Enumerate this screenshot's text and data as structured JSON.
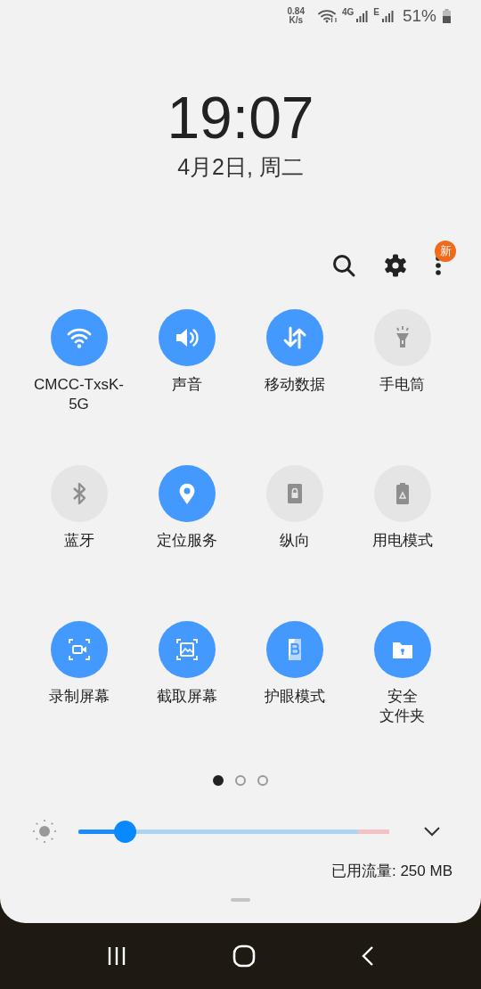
{
  "status_bar": {
    "speed_value": "0.84",
    "speed_unit": "K/s",
    "network_1": "4G",
    "network_2": "E",
    "battery": "51%"
  },
  "clock": {
    "time": "19:07",
    "date": "4月2日, 周二"
  },
  "toolbar": {
    "badge": "新"
  },
  "tiles": [
    {
      "label": [
        "CMCC-TxsK-5G"
      ],
      "on": true
    },
    {
      "label": [
        "声音"
      ],
      "on": true
    },
    {
      "label": [
        "移动数据"
      ],
      "on": true
    },
    {
      "label": [
        "手电筒"
      ],
      "on": false
    },
    {
      "label": [
        "蓝牙"
      ],
      "on": false
    },
    {
      "label": [
        "定位服务"
      ],
      "on": true
    },
    {
      "label": [
        "纵向"
      ],
      "on": false
    },
    {
      "label": [
        "用电模式"
      ],
      "on": false
    },
    {
      "label": [
        "录制屏幕"
      ],
      "on": true
    },
    {
      "label": [
        "截取屏幕"
      ],
      "on": true
    },
    {
      "label": [
        "护眼模式"
      ],
      "on": true
    },
    {
      "label": [
        "安全",
        "文件夹"
      ],
      "on": true
    }
  ],
  "pages": [
    {
      "selected": true
    },
    {
      "selected": false
    },
    {
      "selected": false
    }
  ],
  "brightness": {
    "level": 0.15
  },
  "data_usage": "已用流量: 250 MB"
}
